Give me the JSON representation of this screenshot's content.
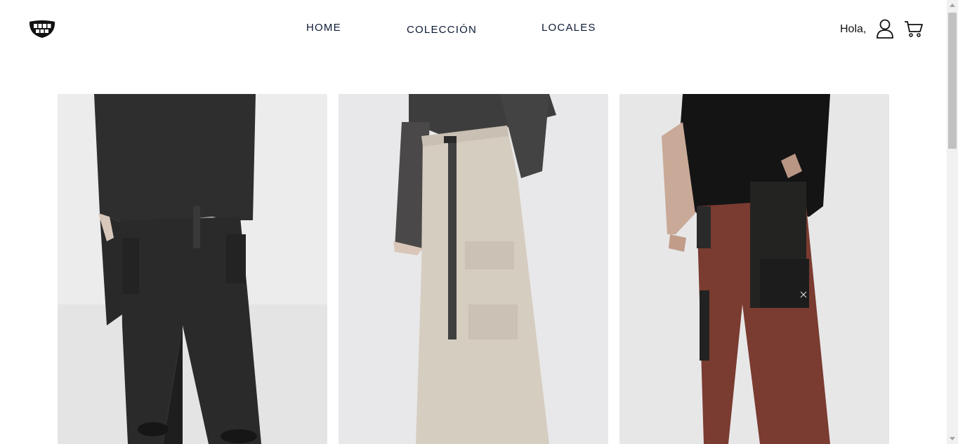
{
  "header": {
    "logo_icon": "grinning-mouth-logo",
    "nav": [
      {
        "label": "HOME"
      },
      {
        "label": "COLECCIÓN"
      },
      {
        "label": "LOCALES"
      }
    ],
    "greeting": "Hola,",
    "user_icon": "user-icon",
    "cart_icon": "shopping-cart-icon"
  },
  "products": [
    {
      "image": "product-photo",
      "garment_color": "#2b2a2a"
    },
    {
      "image": "product-photo",
      "garment_color": "#d6cdc1"
    },
    {
      "image": "product-photo",
      "garment_color": "#7a3b30"
    }
  ]
}
